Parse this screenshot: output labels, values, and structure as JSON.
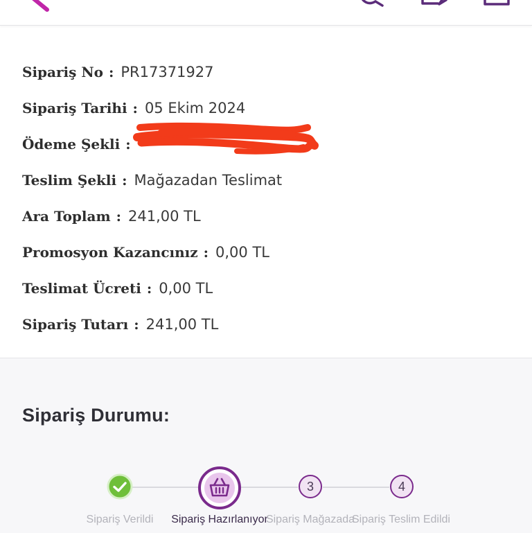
{
  "header": {
    "icons": [
      "back-icon",
      "search-icon",
      "edit-icon",
      "cart-icon"
    ]
  },
  "order_details": [
    {
      "label": "Sipariş No",
      "value": "PR17371927"
    },
    {
      "label": "Sipariş Tarihi",
      "value": "05 Ekim 2024"
    },
    {
      "label": "Ödeme Şekli",
      "value": ""
    },
    {
      "label": "Teslim Şekli",
      "value": "Mağazadan Teslimat"
    },
    {
      "label": "Ara Toplam",
      "value": "241,00 TL"
    },
    {
      "label": "Promosyon Kazancınız",
      "value": "0,00 TL"
    },
    {
      "label": "Teslimat Ücreti",
      "value": "0,00 TL"
    },
    {
      "label": "Sipariş Tutarı",
      "value": "241,00 TL"
    }
  ],
  "separator": ":",
  "status": {
    "title": "Sipariş Durumu:",
    "steps": [
      {
        "label": "Sipariş Verildi",
        "state": "done",
        "icon": "check-icon"
      },
      {
        "label": "Sipariş Hazırlanıyor",
        "state": "active",
        "icon": "basket-icon"
      },
      {
        "label": "Sipariş Mağazada",
        "state": "pending",
        "number": "3"
      },
      {
        "label": "Sipariş Teslim Edildi",
        "state": "pending",
        "number": "4"
      }
    ]
  },
  "colors": {
    "accent": "#7a2a8c",
    "done": "#6fbf3a",
    "redaction": "#f23b1a",
    "muted": "#b3b3ba"
  }
}
